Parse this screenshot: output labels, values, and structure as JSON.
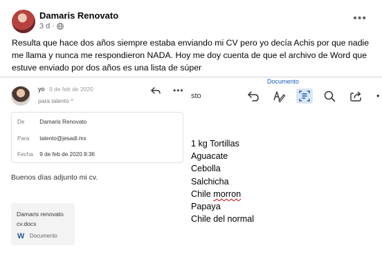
{
  "post": {
    "author": "Damaris Renovato",
    "time": "3 d",
    "separator": "·",
    "more_glyph": "•••",
    "text": "Resulta que hace dos años siempre estaba enviando mi CV pero yo decía Achis por que nadie me llama y nunca me respondieron NADA. Hoy me doy cuenta de que el archivo de Word que estuve enviado por dos años es una lista de súper",
    "privacy_icon": "globe-icon"
  },
  "email": {
    "from": "yo",
    "date": "9 de feb de 2020",
    "to_line": "para talento ^",
    "more_glyph": "•••",
    "details": {
      "de_label": "De",
      "de_value": "Damaris Renovato",
      "para_label": "Para",
      "para_value": "talento@jesadi.mx",
      "fecha_label": "Fecha",
      "fecha_value": "9 de feb de 2020 8:36"
    },
    "body": "Buenos días adjunto mi cv.",
    "attachment": {
      "name_line1": "Damaris renovato",
      "name_line2": "cv.docx",
      "type": "Documento",
      "icon": "word-icon"
    }
  },
  "document": {
    "title": "Documento",
    "toolbar_fragment": "sto",
    "more_glyph": "•",
    "lines": [
      "1 kg Tortillas",
      "Aguacate",
      "Cebolla",
      "Salchicha",
      "Chile",
      "morron",
      "Papaya",
      "Chile del normal"
    ],
    "misspelled_color": "#d00000"
  },
  "colors": {
    "accent_blue": "#1a5fb4",
    "secondary_text": "#65676b",
    "word_blue": "#2b579a",
    "active_tool_bg": "#dbe6f4"
  }
}
